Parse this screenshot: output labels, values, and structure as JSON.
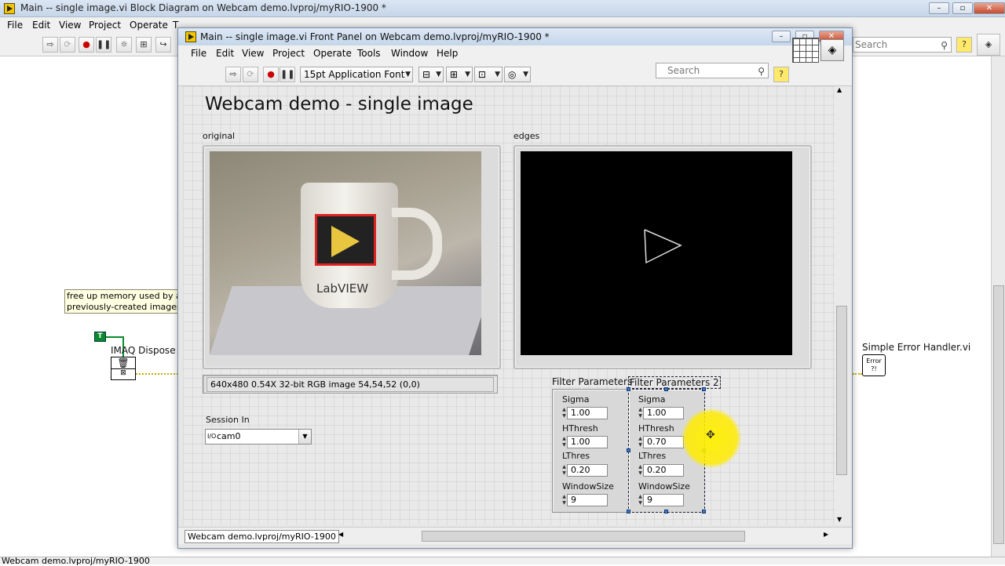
{
  "block_diagram": {
    "title": "Main -- single image.vi Block Diagram on Webcam demo.lvproj/myRIO-1900 *",
    "menu": [
      "File",
      "Edit",
      "View",
      "Project",
      "Operate",
      "T"
    ],
    "search_placeholder": "Search",
    "comment_line1": "free up memory used by ar",
    "comment_line2": "previously-created images",
    "true_constant": "T",
    "imaq_dispose_label": "IMAQ Dispose",
    "error_handler_label": "Simple Error Handler.vi",
    "error_glyph": "Error ?!",
    "status_project": "Webcam demo.lvproj/myRIO-1900"
  },
  "front_panel": {
    "title": "Main -- single image.vi Front Panel on Webcam demo.lvproj/myRIO-1900 *",
    "menu": [
      "File",
      "Edit",
      "View",
      "Project",
      "Operate",
      "Tools",
      "Window",
      "Help"
    ],
    "font_dropdown": "15pt Application Font",
    "search_placeholder": "Search",
    "panel_title": "Webcam demo - single image",
    "original_label": "original",
    "edges_label": "edges",
    "image_info": "640x480 0.54X 32-bit RGB image 54,54,52    (0,0)",
    "mug_logo_text": "LabVIEW",
    "session_label": "Session In",
    "session_value": "cam0",
    "session_prefix": "I/O",
    "status_project": "Webcam demo.lvproj/myRIO-1900",
    "clusters": [
      {
        "title": "Filter Parameters",
        "fields": [
          {
            "label": "Sigma",
            "value": "1.00"
          },
          {
            "label": "HThresh",
            "value": "1.00"
          },
          {
            "label": "LThres",
            "value": "0.20"
          },
          {
            "label": "WindowSize",
            "value": "9"
          }
        ]
      },
      {
        "title": "Filter Parameters 2",
        "fields": [
          {
            "label": "Sigma",
            "value": "1.00"
          },
          {
            "label": "HThresh",
            "value": "0.70"
          },
          {
            "label": "LThres",
            "value": "0.20"
          },
          {
            "label": "WindowSize",
            "value": "9"
          }
        ]
      }
    ]
  },
  "icons": {
    "run": "run-arrow-icon",
    "abort": "abort-icon",
    "pause": "pause-icon",
    "highlight": "lightbulb-icon",
    "help": "context-help-icon"
  },
  "colors": {
    "cursor_highlight": "#ffeb00",
    "wire_bool": "#0a8a2a",
    "wire_error": "#c4a800"
  }
}
